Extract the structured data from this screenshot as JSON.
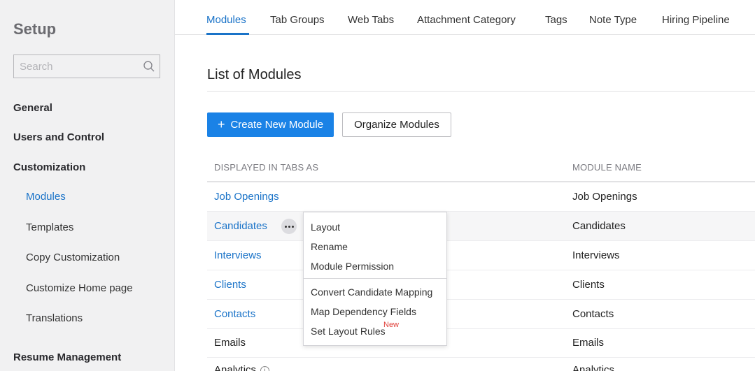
{
  "sidebar": {
    "title": "Setup",
    "search_placeholder": "Search",
    "sections": [
      {
        "label": "General"
      },
      {
        "label": "Users and Control"
      },
      {
        "label": "Customization"
      }
    ],
    "sub_items": [
      {
        "label": "Modules",
        "active": true
      },
      {
        "label": "Templates"
      },
      {
        "label": "Copy Customization"
      },
      {
        "label": "Customize Home page"
      },
      {
        "label": "Translations"
      }
    ],
    "resume_section": "Resume Management"
  },
  "tabs": [
    {
      "label": "Modules",
      "active": true
    },
    {
      "label": "Tab Groups"
    },
    {
      "label": "Web Tabs"
    },
    {
      "label": "Attachment Category"
    },
    {
      "label": "Tags"
    },
    {
      "label": "Note Type"
    },
    {
      "label": "Hiring Pipeline"
    }
  ],
  "main": {
    "title": "List of Modules",
    "create_button": "Create New Module",
    "organize_button": "Organize Modules",
    "columns": [
      "DISPLAYED IN TABS AS",
      "MODULE NAME"
    ],
    "rows": [
      {
        "tab": "Job Openings",
        "name": "Job Openings"
      },
      {
        "tab": "Candidates",
        "name": "Candidates"
      },
      {
        "tab": "Interviews",
        "name": "Interviews"
      },
      {
        "tab": "Clients",
        "name": "Clients"
      },
      {
        "tab": "Contacts",
        "name": "Contacts"
      },
      {
        "tab": "Emails",
        "name": "Emails"
      },
      {
        "tab": "Analytics",
        "name": "Analytics"
      }
    ]
  },
  "menu": {
    "items": [
      "Layout",
      "Rename",
      "Module Permission",
      "Convert Candidate Mapping",
      "Map Dependency Fields",
      "Set Layout Rules"
    ],
    "new_badge": "New"
  },
  "colors": {
    "accent": "#1a73c8",
    "primary_button": "#1a82e6",
    "sidebar_bg": "#f1f1f2",
    "badge": "#e0403a"
  }
}
